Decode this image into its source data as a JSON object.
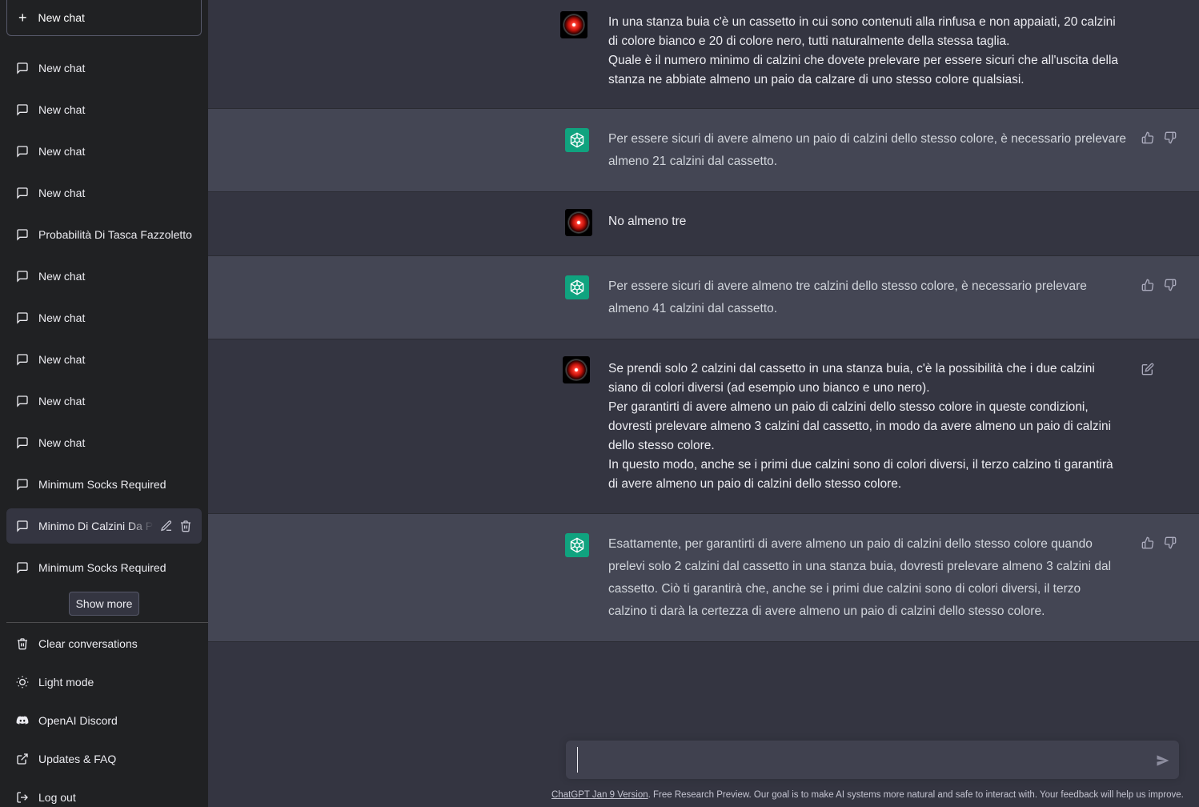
{
  "sidebar": {
    "new_chat_label": "New chat",
    "chats": [
      {
        "label": "New chat"
      },
      {
        "label": "New chat"
      },
      {
        "label": "New chat"
      },
      {
        "label": "New chat"
      },
      {
        "label": "Probabilità Di Tasca Fazzoletto"
      },
      {
        "label": "New chat"
      },
      {
        "label": "New chat"
      },
      {
        "label": "New chat"
      },
      {
        "label": "New chat"
      },
      {
        "label": "New chat"
      },
      {
        "label": "Minimum Socks Required"
      },
      {
        "label": "Minimo Di Calzini Da Prelevare",
        "active": true
      },
      {
        "label": "Minimum Socks Required"
      }
    ],
    "show_more_label": "Show more",
    "bottom": {
      "clear": "Clear conversations",
      "light": "Light mode",
      "discord": "OpenAI Discord",
      "updates": "Updates & FAQ",
      "logout": "Log out"
    }
  },
  "messages": [
    {
      "role": "user",
      "lines": [
        "In una stanza buia c'è un cassetto in cui sono contenuti alla rinfusa e non appaiati, 20 calzini",
        "di colore bianco e 20 di colore nero, tutti naturalmente della stessa taglia.",
        "Quale è il numero minimo di calzini che dovete prelevare per essere sicuri che all'uscita della",
        "stanza ne abbiate almeno un paio da calzare di uno stesso colore qualsiasi."
      ]
    },
    {
      "role": "assistant",
      "lines": [
        "Per essere sicuri di avere almeno un paio di calzini dello stesso colore, è necessario prelevare",
        "almeno 21 calzini dal cassetto."
      ]
    },
    {
      "role": "user",
      "lines": [
        "No almeno tre"
      ]
    },
    {
      "role": "assistant",
      "lines": [
        "Per essere sicuri di avere almeno tre calzini dello stesso colore, è necessario prelevare",
        "almeno 41 calzini dal cassetto."
      ]
    },
    {
      "role": "user",
      "lines": [
        "Se prendi solo 2 calzini dal cassetto in una stanza buia, c'è la possibilità che i due calzini",
        "siano di colori diversi (ad esempio uno bianco e uno nero).",
        "Per garantirti di avere almeno un paio di calzini dello stesso colore in queste condizioni,",
        "dovresti prelevare almeno 3 calzini dal cassetto, in modo da avere almeno un paio di calzini",
        "dello stesso colore.",
        "In questo modo, anche se i primi due calzini sono di colori diversi, il terzo calzino ti garantirà",
        "di avere almeno un paio di calzini dello stesso colore."
      ]
    },
    {
      "role": "assistant",
      "lines": [
        "Esattamente, per garantirti di avere almeno un paio di calzini dello stesso colore quando",
        "prelevi solo 2 calzini dal cassetto in una stanza buia, dovresti prelevare almeno 3 calzini dal",
        "cassetto. Ciò ti garantirà che, anche se i primi due calzini sono di colori diversi, il terzo",
        "calzino ti darà la certezza di avere almeno un paio di calzini dello stesso colore."
      ]
    }
  ],
  "input": {
    "value": ""
  },
  "footer": {
    "version_link": "ChatGPT Jan 9 Version",
    "text": ". Free Research Preview. Our goal is to make AI systems more natural and safe to interact with. Your feedback will help us improve."
  },
  "colors": {
    "sidebar_bg": "#202123",
    "main_bg": "#343541",
    "bot_bg": "#444654",
    "gpt_avatar": "#10a37f"
  }
}
